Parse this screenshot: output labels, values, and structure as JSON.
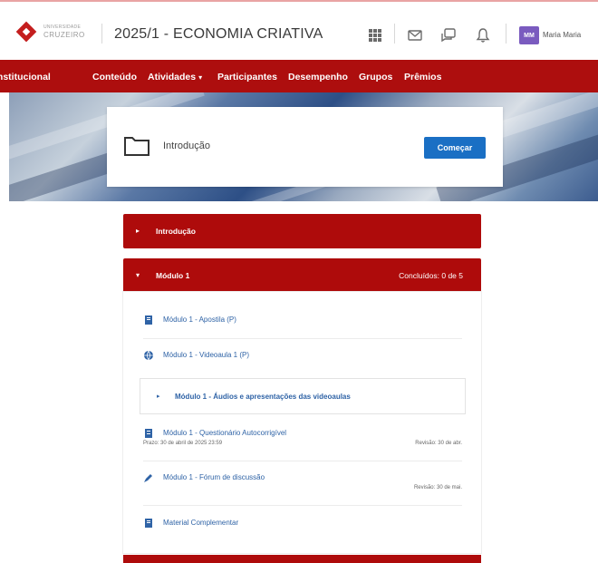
{
  "header": {
    "logo_small": "UNIVERSIDADE",
    "logo_big": "CRUZEIRO",
    "course_title": "2025/1 - ECONOMIA CRIATIVA",
    "avatar_initials": "MM",
    "user_name": "Maria Maria"
  },
  "nav": {
    "items": [
      "Institucional",
      "Conteúdo",
      "Atividades",
      "Participantes",
      "Desempenho",
      "Grupos",
      "Prêmios"
    ],
    "dropdown_caret": "▾"
  },
  "intro_card": {
    "title": "Introdução",
    "start_label": "Começar"
  },
  "sections": [
    {
      "label": "Introdução",
      "caret": "▸",
      "status": ""
    },
    {
      "label": "Módulo 1",
      "caret": "▾",
      "status": "Concluídos: 0 de 5"
    }
  ],
  "module1": {
    "activities": [
      {
        "title": "Módulo 1 - Apostila (P)",
        "icon": "book-icon",
        "sub": "",
        "right": ""
      },
      {
        "title": "Módulo 1 - Videoaula 1 (P)",
        "icon": "globe-icon",
        "sub": "",
        "right": ""
      },
      {
        "title": "Módulo 1 - Questionário Autocorrigível",
        "icon": "quiz-icon",
        "sub": "Prazo: 30 de abril de 2025 23:59",
        "right": "Revisão: 30 de abr."
      },
      {
        "title": "Módulo 1 - Fórum de discussão",
        "icon": "forum-icon",
        "sub": "",
        "right": "Revisão: 30 de mai."
      },
      {
        "title": "Material Complementar",
        "icon": "book-icon",
        "sub": "",
        "right": ""
      }
    ],
    "subsection": {
      "caret": "▸",
      "label": "Módulo 1 - Áudios e apresentações das videoaulas"
    }
  },
  "colors": {
    "brand_red": "#ad0e0e",
    "link_blue": "#2f63a6",
    "button_blue": "#1a6fc4",
    "avatar_purple": "#7a5bbf"
  }
}
